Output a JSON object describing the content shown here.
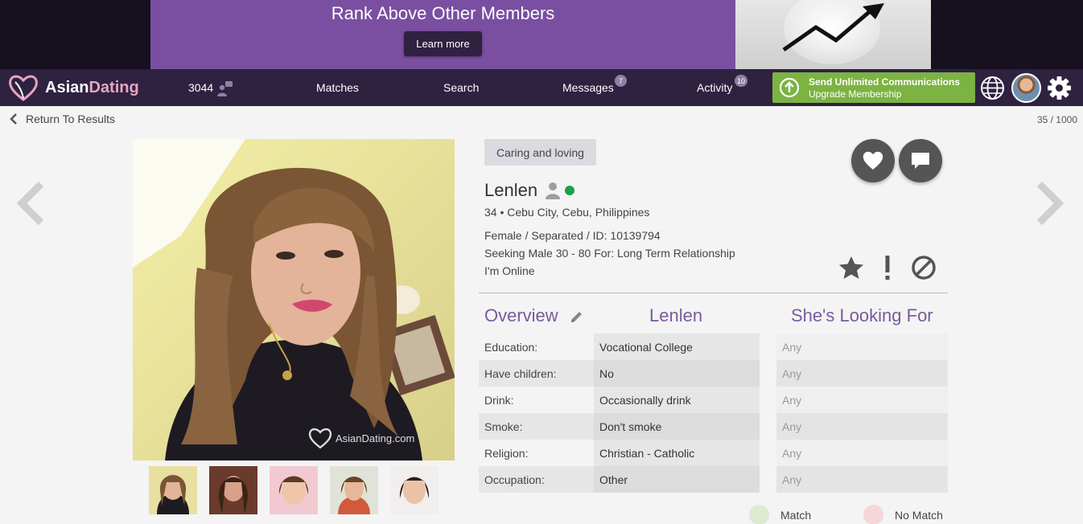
{
  "banner": {
    "title": "Rank Above Other Members",
    "button": "Learn more"
  },
  "nav": {
    "logo_prefix": "Asian",
    "logo_suffix": "Dating",
    "count": "3044",
    "matches": "Matches",
    "search": "Search",
    "messages": "Messages",
    "messages_badge": "7",
    "activity": "Activity",
    "activity_badge": "10",
    "upgrade_line1": "Send Unlimited Communications",
    "upgrade_line2": "Upgrade Membership"
  },
  "subheader": {
    "return": "Return To Results",
    "counter": "35 / 1000"
  },
  "photo": {
    "watermark": "AsianDating.com"
  },
  "profile": {
    "tagline": "Caring and loving",
    "name": "Lenlen",
    "location": "34 • Cebu City, Cebu, Philippines",
    "details": "Female / Separated / ID: 10139794",
    "seeking": "Seeking Male 30 - 80 For: Long Term Relationship",
    "status": "I'm Online"
  },
  "table": {
    "headers": [
      "Overview",
      "Lenlen",
      "She's Looking For"
    ],
    "rows": [
      {
        "label": "Education:",
        "value": "Vocational College",
        "looking": "Any"
      },
      {
        "label": "Have children:",
        "value": "No",
        "looking": "Any"
      },
      {
        "label": "Drink:",
        "value": "Occasionally drink",
        "looking": "Any"
      },
      {
        "label": "Smoke:",
        "value": "Don't smoke",
        "looking": "Any"
      },
      {
        "label": "Religion:",
        "value": "Christian - Catholic",
        "looking": "Any"
      },
      {
        "label": "Occupation:",
        "value": "Other",
        "looking": "Any"
      }
    ]
  },
  "legend": {
    "match": "Match",
    "no_match": "No Match"
  },
  "colors": {
    "brand_purple": "#7a4fa2",
    "nav_bg": "#2e2240",
    "upgrade_green": "#7cb342",
    "online_green": "#1aa04a",
    "match_dot": "#dcebd0",
    "no_match_dot": "#f6d6d6"
  },
  "icons": [
    "heart-icon",
    "chat-icon",
    "star-icon",
    "exclamation-icon",
    "block-icon",
    "pencil-icon",
    "globe-icon",
    "gear-icon",
    "person-icon",
    "chevron-left-icon",
    "chevron-right-icon",
    "upload-arrow-icon"
  ]
}
